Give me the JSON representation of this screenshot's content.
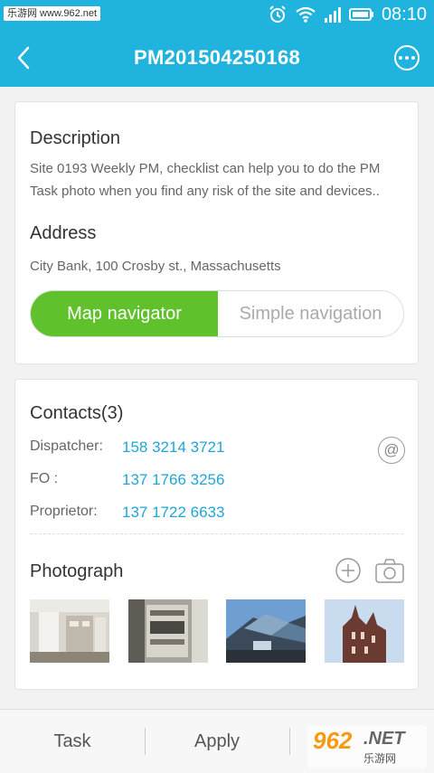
{
  "status_bar": {
    "watermark": "乐游网 www.962.net",
    "time": "08:10"
  },
  "header": {
    "title": "PM201504250168",
    "back_icon": "chevron-left-icon",
    "more_icon": "more-dots-icon"
  },
  "description": {
    "heading": "Description",
    "line1": "Site 0193 Weekly PM, checklist can help you to do the PM",
    "line2": "Task photo when you find any risk of the site and devices.."
  },
  "address": {
    "heading": "Address",
    "value": "City Bank, 100 Crosby st., Massachusetts"
  },
  "navigation": {
    "selected": "Map navigator",
    "options": [
      "Map navigator",
      "Simple navigation"
    ]
  },
  "contacts": {
    "heading": "Contacts(3)",
    "items": [
      {
        "label": "Dispatcher:",
        "phone": "158 3214 3721"
      },
      {
        "label": "FO :",
        "phone": "137 1766 3256"
      },
      {
        "label": "Proprietor:",
        "phone": "137 1722 6633"
      }
    ],
    "email_icon": "at-icon"
  },
  "photograph": {
    "heading": "Photograph",
    "add_icon": "add-circle-icon",
    "camera_icon": "camera-icon",
    "photos": [
      "equipment-room-photo",
      "server-rack-photo",
      "modern-building-photo",
      "tower-building-photo"
    ]
  },
  "bottom_bar": {
    "tabs": [
      "Task",
      "Apply",
      ""
    ]
  },
  "watermark_logo": {
    "number": "962",
    "suffix": ".NET",
    "chinese": "乐游网"
  },
  "colors": {
    "primary": "#1fb3dd",
    "accent_green": "#5fc12b",
    "link_blue": "#1fa6d6"
  }
}
